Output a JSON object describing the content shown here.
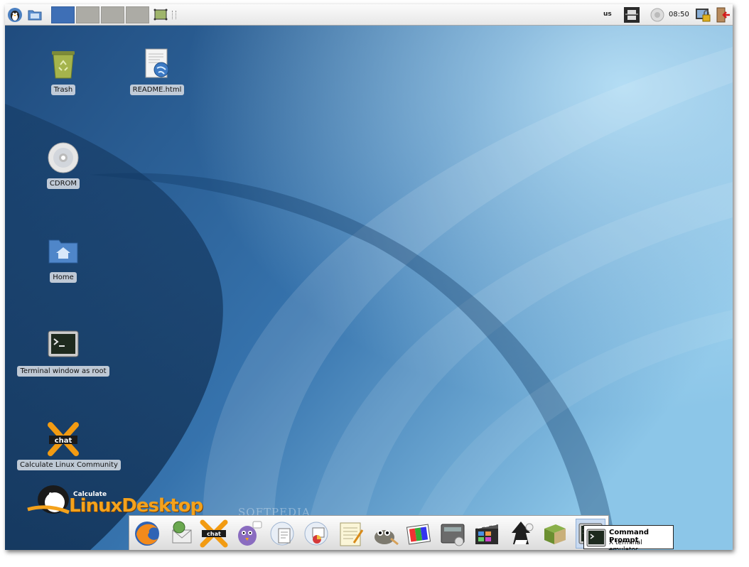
{
  "panel": {
    "keyboard_layout": "us",
    "clock": "08:50",
    "workspaces": [
      {
        "name": "workspace-1",
        "active": true
      },
      {
        "name": "workspace-2",
        "active": false
      },
      {
        "name": "workspace-3",
        "active": false
      },
      {
        "name": "workspace-4",
        "active": false
      }
    ]
  },
  "desktop": {
    "icons": [
      {
        "label": "Trash",
        "icon": "trash-icon"
      },
      {
        "label": "README.html",
        "icon": "html-document-icon"
      },
      {
        "label": "CDROM",
        "icon": "cdrom-icon"
      },
      {
        "label": "Home",
        "icon": "home-folder-icon"
      },
      {
        "label": "Terminal window as root",
        "icon": "terminal-icon"
      },
      {
        "label": "Calculate Linux Community",
        "icon": "xchat-icon"
      }
    ],
    "logo": {
      "small": "Calculate",
      "big": "LinuxDesktop"
    },
    "watermark": "SOFTPEDIA"
  },
  "dock": {
    "items": [
      "firefox-icon",
      "mail-icon",
      "xchat-icon",
      "pidgin-icon",
      "office-writer-icon",
      "office-impress-icon",
      "text-editor-icon",
      "gimp-icon",
      "image-viewer-icon",
      "scanner-icon",
      "video-player-icon",
      "inkscape-icon",
      "books-icon",
      "terminal-icon"
    ],
    "tooltip": {
      "title": "Command Prompt",
      "subtitle": "X terminal emulator"
    }
  },
  "colors": {
    "accent": "#3e6fb6",
    "wallpaper": "#2e5f95"
  }
}
